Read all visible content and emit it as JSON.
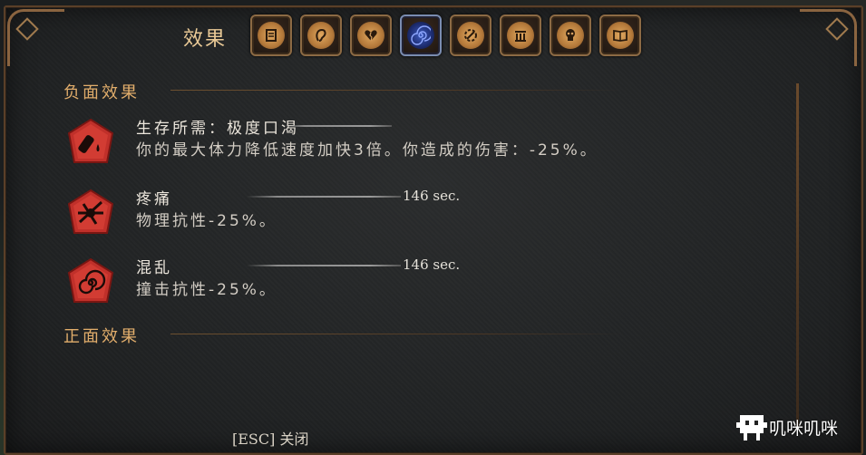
{
  "header": {
    "title": "效果",
    "tabs": [
      {
        "icon": "scroll-icon",
        "active": false
      },
      {
        "icon": "ear-icon",
        "active": false
      },
      {
        "icon": "broken-heart-icon",
        "active": false
      },
      {
        "icon": "spiral-icon",
        "active": true
      },
      {
        "icon": "gear-hammer-icon",
        "active": false
      },
      {
        "icon": "building-icon",
        "active": false
      },
      {
        "icon": "skull-icon",
        "active": false
      },
      {
        "icon": "book-icon",
        "active": false
      }
    ]
  },
  "negative": {
    "heading": "负面效果",
    "effects": [
      {
        "name": "生存所需：极度口渴",
        "desc": "你的最大体力降低速度加快3倍。你造成的伤害：-25%。",
        "timer": "",
        "icon": "bottle-drop-icon"
      },
      {
        "name": "疼痛",
        "desc": "物理抗性-25%。",
        "timer": "146 sec.",
        "icon": "thorn-burst-icon"
      },
      {
        "name": "混乱",
        "desc": "撞击抗性-25%。",
        "timer": "146 sec.",
        "icon": "swirl-icon"
      }
    ]
  },
  "positive": {
    "heading": "正面效果"
  },
  "footer": {
    "close_label": "[ESC] 关闭"
  },
  "watermark": {
    "text": "叽咪叽咪"
  },
  "colors": {
    "accent": "#e1ad6b",
    "badge_red": "#c0302a",
    "frame": "#8c6a44"
  }
}
